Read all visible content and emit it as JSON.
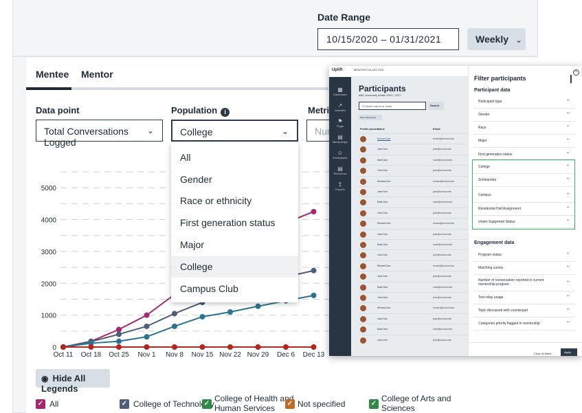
{
  "date_range": {
    "label": "Date Range",
    "value": "10/15/2020 – 01/31/2021",
    "interval": "Weekly"
  },
  "tabs": [
    {
      "label": "Mentee"
    },
    {
      "label": "Mentor"
    }
  ],
  "filters": {
    "data_point": {
      "label": "Data point",
      "value": "Total Conversations Logged"
    },
    "population": {
      "label": "Population",
      "value": "College"
    },
    "metric": {
      "label": "Metric",
      "placeholder": "Num"
    }
  },
  "population_options": [
    "All",
    "Gender",
    "Race or ethnicity",
    "First generation status",
    "Major",
    "College",
    "Campus Club"
  ],
  "chart_data": {
    "type": "line",
    "categories": [
      "Oct 11",
      "Oct 18",
      "Oct 25",
      "Nov 1",
      "Nov 8",
      "Nov 15",
      "Nov 22",
      "Nov 29",
      "Dec 6",
      "Dec 13"
    ],
    "y_ticks": [
      "0",
      "1000",
      "2000",
      "3000",
      "4000",
      "5000"
    ],
    "ylim": [
      0,
      5500
    ],
    "grid": true,
    "series": [
      {
        "name": "College of Health and Human Services",
        "color": "#a3286e",
        "values": [
          0,
          180,
          550,
          1000,
          1650,
          2300,
          2950,
          3400,
          3900,
          4250
        ]
      },
      {
        "name": "College of Technology",
        "color": "#4c5e7a",
        "values": [
          0,
          170,
          400,
          650,
          1050,
          1400,
          1700,
          1950,
          2200,
          2400
        ]
      },
      {
        "name": "All",
        "color": "#2a7490",
        "values": [
          0,
          120,
          180,
          320,
          650,
          950,
          1100,
          1280,
          1450,
          1620
        ]
      },
      {
        "name": "Not specified",
        "color": "#b3261e",
        "values": [
          0,
          0,
          0,
          0,
          0,
          0,
          0,
          0,
          0,
          0
        ]
      }
    ]
  },
  "legend_button": {
    "label": "Hide All Legends"
  },
  "legend": [
    {
      "label": "All",
      "color": "#a3286e"
    },
    {
      "label": "College of Technology",
      "color": "#4c5e7a"
    },
    {
      "label_1": "College of Health and",
      "label_2": "Human Services",
      "color": "#2e8a45"
    },
    {
      "label": "Not specified",
      "color": "#c06a26"
    },
    {
      "label_1": "College of Arts and",
      "label_2": "Sciences",
      "color": "#2e8a45"
    }
  ],
  "participants": {
    "brand": "MENTOR COLLECTIVE",
    "nav": [
      {
        "icon": "dashboard-icon",
        "label": "Dashboard"
      },
      {
        "icon": "activities-icon",
        "label": "Activities"
      },
      {
        "icon": "flag-icon",
        "label": "Flags"
      },
      {
        "icon": "mentorships-icon",
        "label": "Mentorships"
      },
      {
        "icon": "participants-icon",
        "label": "Participants"
      },
      {
        "icon": "resources-icon",
        "label": "Resources"
      },
      {
        "icon": "exports-icon",
        "label": "Exports"
      }
    ],
    "title": "Participants",
    "subtitle": "ABC University Winter 2022 | 1227",
    "search_placeholder": "Search name or email",
    "search_button": "Search",
    "filter_button": "Filter Participants",
    "columns": [
      "Profile picture",
      "Name",
      "Email"
    ],
    "rows": [
      {
        "name": "Richard Doe",
        "email": "richard@school.edu"
      },
      {
        "name": "Jane Doe",
        "email": "jane@school.edu"
      },
      {
        "name": "Mark Doe",
        "email": "mark@school.edu"
      },
      {
        "name": "John Doe",
        "email": "john@school.edu"
      },
      {
        "name": "Richard Doe",
        "email": "richard@school.edu"
      },
      {
        "name": "Jane Doe",
        "email": "jane@school.edu"
      },
      {
        "name": "Mark Doe",
        "email": "mark@school.edu"
      },
      {
        "name": "John Doe",
        "email": "john@school.edu"
      },
      {
        "name": "Richard Doe",
        "email": "richard@school.edu"
      },
      {
        "name": "Jane Doe",
        "email": "jane@school.edu"
      },
      {
        "name": "Mark Doe",
        "email": "mark@school.edu"
      },
      {
        "name": "John Doe",
        "email": "john@school.edu"
      },
      {
        "name": "Richard Doe",
        "email": "richard@school.edu"
      },
      {
        "name": "Jane Doe",
        "email": "jane@school.edu"
      },
      {
        "name": "Mark Doe",
        "email": "mark@school.edu"
      },
      {
        "name": "John Doe",
        "email": "john@school.edu"
      },
      {
        "name": "Richard Doe",
        "email": "richard@school.edu"
      },
      {
        "name": "Jane Doe",
        "email": "jane@school.edu"
      },
      {
        "name": "Mark Doe",
        "email": "mark@school.edu"
      },
      {
        "name": "John Doe",
        "email": "john@school.edu"
      }
    ]
  },
  "filter_panel": {
    "title": "Filter participants",
    "participant_section": "Participant data",
    "participant_items": [
      "Participant type",
      "Gender",
      "Race",
      "Major",
      "First generation status",
      "College",
      "Scholarship",
      "Campus",
      "Residential Hall Assignment",
      "Under Supported Status"
    ],
    "engagement_section": "Engagement data",
    "engagement_items": [
      "Program status",
      "Matching survey",
      "Number of conversation reported in current mentorship program",
      "Text relay usage",
      "Topic discussed with counterpart",
      "Categories priority flagged in mentorship"
    ],
    "clear_label": "Clear all filters",
    "apply_label": "Apply"
  }
}
